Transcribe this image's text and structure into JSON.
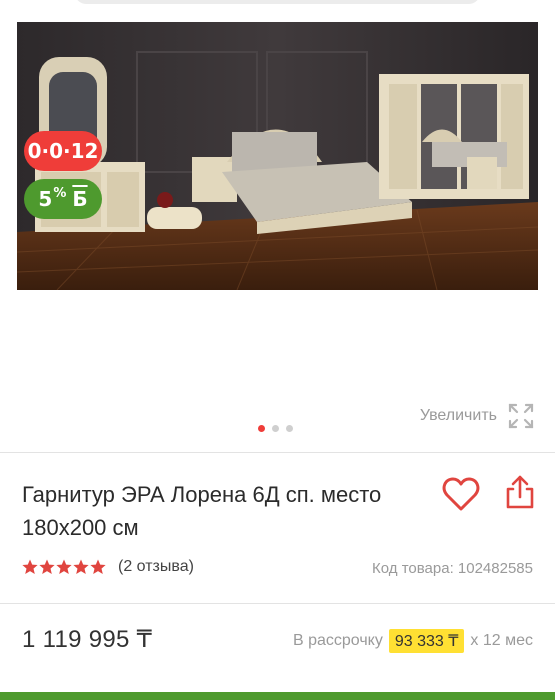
{
  "gallery": {
    "image": "bedroom-furniture-photo",
    "installment_badge": "0·0·12",
    "bonus_badge": {
      "percent": "5",
      "sign": "%",
      "bonus_symbol": "Б"
    },
    "zoom_label": "Увеличить",
    "zoom_icon": "expand-icon",
    "slides": 3,
    "active_slide": 1
  },
  "product": {
    "title": "Гарнитур ЭРА Лорена 6Д сп. место 180х200 см",
    "favorite_icon": "heart-icon",
    "share_icon": "share-icon",
    "rating": 5,
    "reviews_label": "(2 отзыва)",
    "sku_label": "Код товара: 102482585"
  },
  "pricing": {
    "price": "1 119 995 ₸",
    "installment_prefix": "В рассрочку",
    "installment_amount": "93 333 ₸",
    "installment_suffix": "x 12 мес"
  },
  "colors": {
    "accent_red": "#ef3d39",
    "accent_green": "#4e9a2e",
    "highlight_yellow": "#ffe033",
    "star_color": "#e0453f"
  }
}
